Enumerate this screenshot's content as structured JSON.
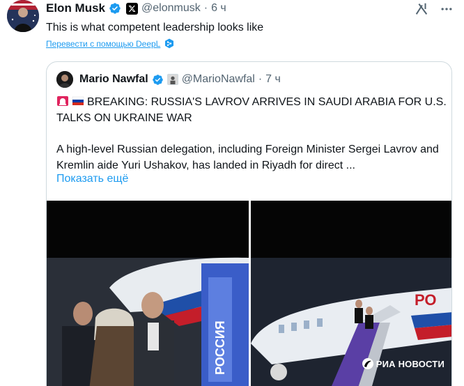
{
  "tweet": {
    "author_name": "Elon Musk",
    "handle": "@elonmusk",
    "separator": "·",
    "time": "6 ч",
    "text": "This is what competent leadership looks like",
    "translate_label": "Перевести с помощью DeepL"
  },
  "quoted": {
    "author_name": "Mario Nawfal",
    "handle": "@MarioNawfal",
    "separator": "·",
    "time": "7 ч",
    "headline": "BREAKING: RUSSIA'S LAVROV ARRIVES IN SAUDI ARABIA FOR U.S. TALKS ON UKRAINE WAR",
    "body": "A high-level Russian delegation, including Foreign Minister Sergei Lavrov and Kremlin aide Yuri Ushakov, has landed in Riyadh for direct ...",
    "show_more": "Показать ещё",
    "media": {
      "left_watermark": "РОССИЯ",
      "right_watermark": "РИА НОВОСТИ",
      "right_plane_text": "РО"
    }
  },
  "icons": {
    "verified": "verified-badge-icon",
    "x_affiliate": "x-logo-icon",
    "grok": "grok-icon",
    "more": "more-dots-icon",
    "deepl": "deepl-icon"
  },
  "colors": {
    "link": "#1d9bf0",
    "verified": "#1d9bf0",
    "secondary_text": "#536471",
    "border": "#cfd9de"
  }
}
